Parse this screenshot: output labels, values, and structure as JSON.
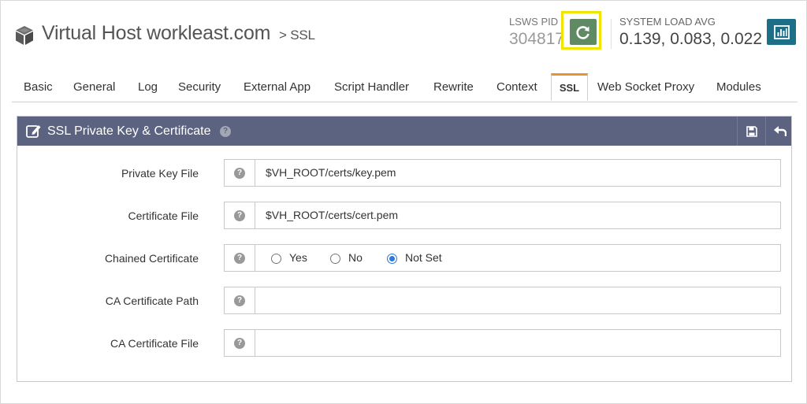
{
  "header": {
    "title": "Virtual Host workleast.com",
    "breadcrumb": "> SSL",
    "pid_label": "LSWS PID",
    "pid_value": "304817",
    "load_label": "SYSTEM LOAD AVG",
    "load_value": "0.139, 0.083, 0.022"
  },
  "tabs": [
    {
      "label": "Basic"
    },
    {
      "label": "General"
    },
    {
      "label": "Log"
    },
    {
      "label": "Security"
    },
    {
      "label": "External App"
    },
    {
      "label": "Script Handler"
    },
    {
      "label": "Rewrite"
    },
    {
      "label": "Context"
    },
    {
      "label": "SSL",
      "active": true
    },
    {
      "label": "Web Socket Proxy"
    },
    {
      "label": "Modules"
    }
  ],
  "panel": {
    "title": "SSL Private Key & Certificate",
    "rows": [
      {
        "label": "Private Key File",
        "value": "$VH_ROOT/certs/key.pem"
      },
      {
        "label": "Certificate File",
        "value": "$VH_ROOT/certs/cert.pem"
      },
      {
        "label": "Chained Certificate",
        "options": [
          "Yes",
          "No",
          "Not Set"
        ],
        "selected": "Not Set"
      },
      {
        "label": "CA Certificate Path",
        "value": ""
      },
      {
        "label": "CA Certificate File",
        "value": ""
      }
    ]
  },
  "icons": {
    "vhost": "cube-icon",
    "restart": "restart-icon",
    "chart": "bar-chart-icon",
    "edit": "edit-icon",
    "help": "question-circle-icon",
    "save": "save-icon",
    "back": "undo-arrow-icon"
  },
  "colors": {
    "panel_header": "#5c6380",
    "restart_button": "#5f8a64",
    "chart_button": "#1d6f88",
    "active_tab_accent": "#e6952e",
    "highlight": "#f0e400",
    "radio_selected": "#2a7ae2"
  }
}
